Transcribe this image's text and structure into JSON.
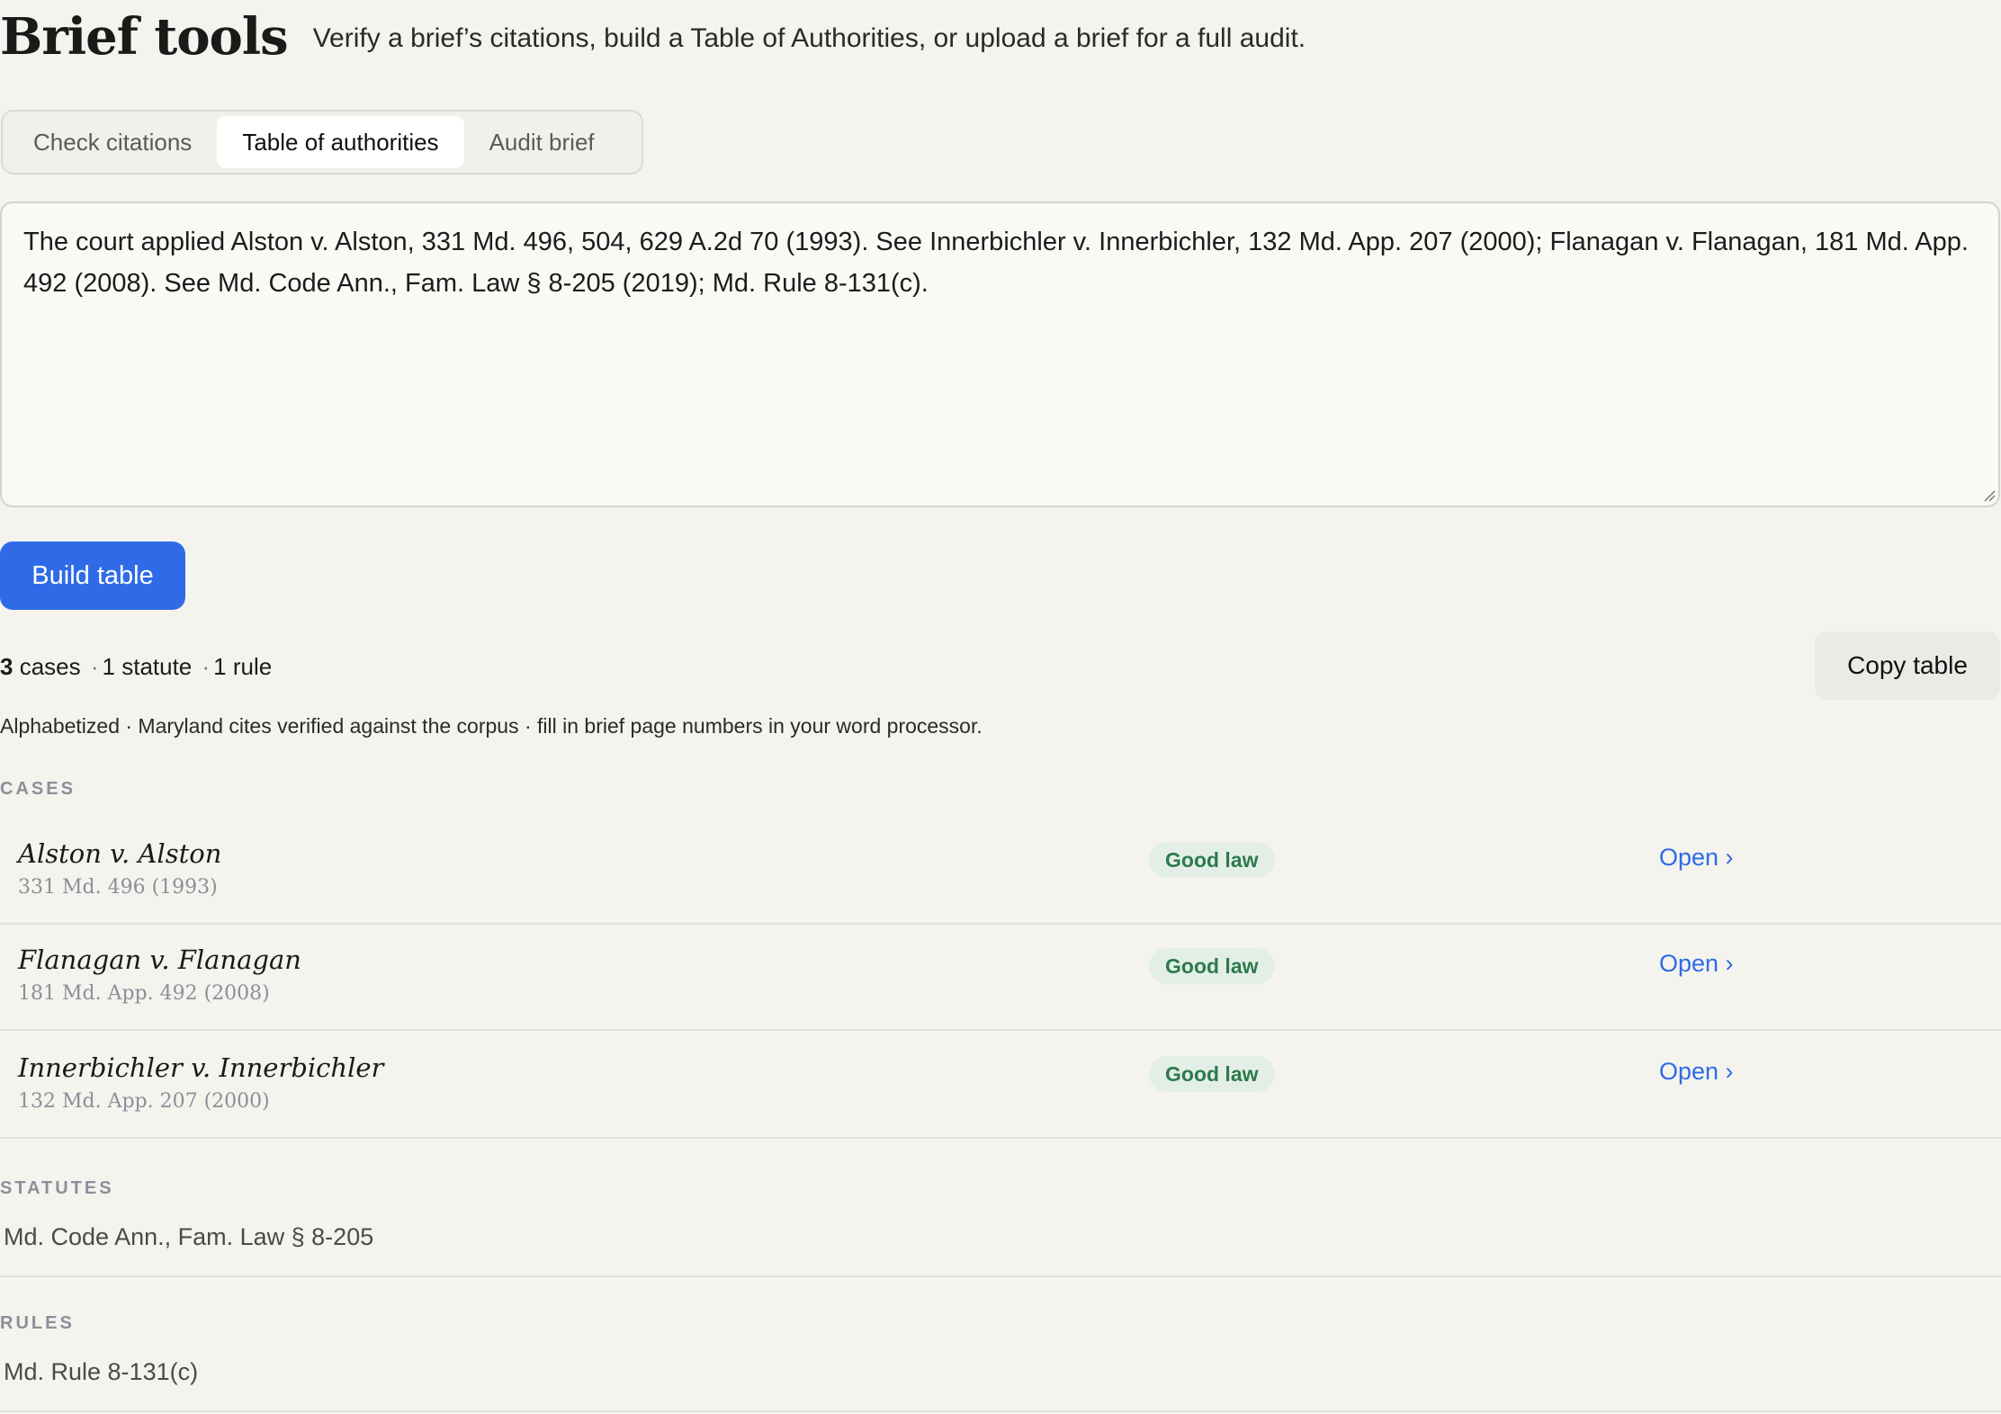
{
  "header": {
    "title": "Brief tools",
    "subtitle": "Verify a brief’s citations, build a Table of Authorities, or upload a brief for a full audit."
  },
  "tabs": [
    {
      "label": "Check citations",
      "active": false
    },
    {
      "label": "Table of authorities",
      "active": true
    },
    {
      "label": "Audit brief",
      "active": false
    }
  ],
  "input": {
    "value": "The court applied Alston v. Alston, 331 Md. 496, 504, 629 A.2d 70 (1993). See Innerbichler v. Innerbichler, 132 Md. App. 207 (2000); Flanagan v. Flanagan, 181 Md. App. 492 (2008). See Md. Code Ann., Fam. Law § 8-205 (2019); Md. Rule 8-131(c)."
  },
  "actions": {
    "build_label": "Build table",
    "copy_label": "Copy table"
  },
  "summary": {
    "cases_count": "3",
    "cases_word": "cases",
    "sep": "·",
    "statutes": "1 statute",
    "rules": "1 rule",
    "note": "Alphabetized · Maryland cites verified against the corpus · fill in brief page numbers in your word processor."
  },
  "sections": {
    "cases_label": "CASES",
    "statutes_label": "STATUTES",
    "rules_label": "RULES"
  },
  "cases": [
    {
      "name": "Alston v. Alston",
      "cite": "331 Md. 496 (1993)",
      "status": "Good law",
      "link": "Open ›"
    },
    {
      "name": "Flanagan v. Flanagan",
      "cite": "181 Md. App. 492 (2008)",
      "status": "Good law",
      "link": "Open ›"
    },
    {
      "name": "Innerbichler v. Innerbichler",
      "cite": "132 Md. App. 207 (2000)",
      "status": "Good law",
      "link": "Open ›"
    }
  ],
  "statutes": [
    {
      "text": "Md. Code Ann., Fam. Law § 8-205"
    }
  ],
  "rules": [
    {
      "text": "Md. Rule 8-131(c)"
    }
  ],
  "colors": {
    "accent": "#2f6be6",
    "badge_bg": "#e3efe6",
    "badge_text": "#2d7a4d",
    "background": "#f4f3ee"
  }
}
